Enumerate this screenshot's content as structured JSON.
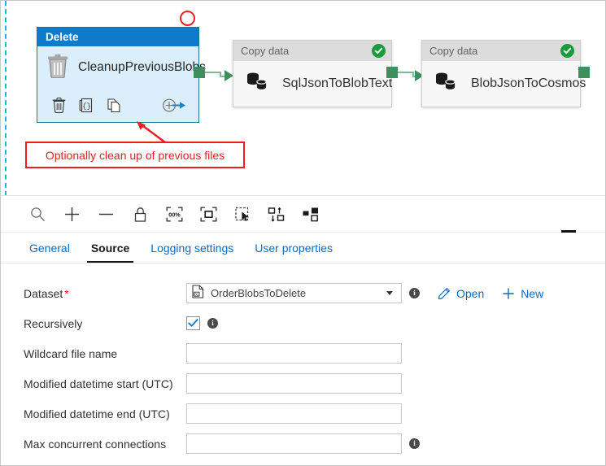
{
  "canvas": {
    "nodes": [
      {
        "id": "delete-node",
        "type_label": "Delete",
        "name": "CleanupPreviousBlobs",
        "icon": "trash-icon",
        "selected": true,
        "actions": [
          "delete-icon",
          "code-braces-icon",
          "duplicate-icon",
          "add-output-icon"
        ]
      },
      {
        "id": "copy-node-1",
        "type_label": "Copy data",
        "name": "SqlJsonToBlobText",
        "icon": "copy-data-icon",
        "status": "succeeded"
      },
      {
        "id": "copy-node-2",
        "type_label": "Copy data",
        "name": "BlobJsonToCosmos",
        "icon": "copy-data-icon",
        "status": "succeeded"
      }
    ],
    "annotations": {
      "callout_text": "Optionally clean up of previous files",
      "callout_color": "#ee1c25",
      "circle_name": "red-circle-annotation"
    },
    "connector_color": "#3f8f5e"
  },
  "toolbar": {
    "buttons": [
      {
        "name": "zoom-search-icon",
        "title": "Zoom"
      },
      {
        "name": "zoom-in-icon",
        "title": "Zoom in"
      },
      {
        "name": "zoom-out-icon",
        "title": "Zoom out"
      },
      {
        "name": "lock-icon",
        "title": "Lock"
      },
      {
        "name": "zoom-100-percent-icon",
        "title": "100%"
      },
      {
        "name": "zoom-to-fit-icon",
        "title": "Zoom to fit"
      },
      {
        "name": "select-region-icon",
        "title": "Select"
      },
      {
        "name": "auto-align-icon",
        "title": "Auto align"
      },
      {
        "name": "layout-icon",
        "title": "Layout"
      }
    ],
    "zoom_level_label": "00%",
    "minimize_name": "minimize-panel-button"
  },
  "tabs": [
    {
      "label": "General",
      "active": false
    },
    {
      "label": "Source",
      "active": true
    },
    {
      "label": "Logging settings",
      "active": false
    },
    {
      "label": "User properties",
      "active": false
    }
  ],
  "form": {
    "rows": [
      {
        "label": "Dataset",
        "required": true,
        "required_mark": "*",
        "control": "combo",
        "value": "OrderBlobsToDelete",
        "info": true,
        "links": [
          {
            "label": "Open",
            "icon": "pencil-icon"
          },
          {
            "label": "New",
            "icon": "plus-icon"
          }
        ]
      },
      {
        "label": "Recursively",
        "required": false,
        "control": "checkbox",
        "checked": true,
        "info": true
      },
      {
        "label": "Wildcard file name",
        "required": false,
        "control": "text",
        "value": "",
        "placeholder": "",
        "info": false
      },
      {
        "label": "Modified datetime start (UTC)",
        "required": false,
        "control": "text",
        "value": "",
        "placeholder": "",
        "info": false
      },
      {
        "label": "Modified datetime end (UTC)",
        "required": false,
        "control": "text",
        "value": "",
        "placeholder": "",
        "info": false
      },
      {
        "label": "Max concurrent connections",
        "required": false,
        "control": "text",
        "value": "",
        "placeholder": "",
        "info": true
      }
    ]
  },
  "colors": {
    "accent_blue": "#0a6cc4",
    "selected_header": "#0f7ac8",
    "selected_body": "#daeefb",
    "success_green": "#1a9c3e",
    "connector_green": "#3f8f5e",
    "annotation_red": "#ee1c25"
  }
}
